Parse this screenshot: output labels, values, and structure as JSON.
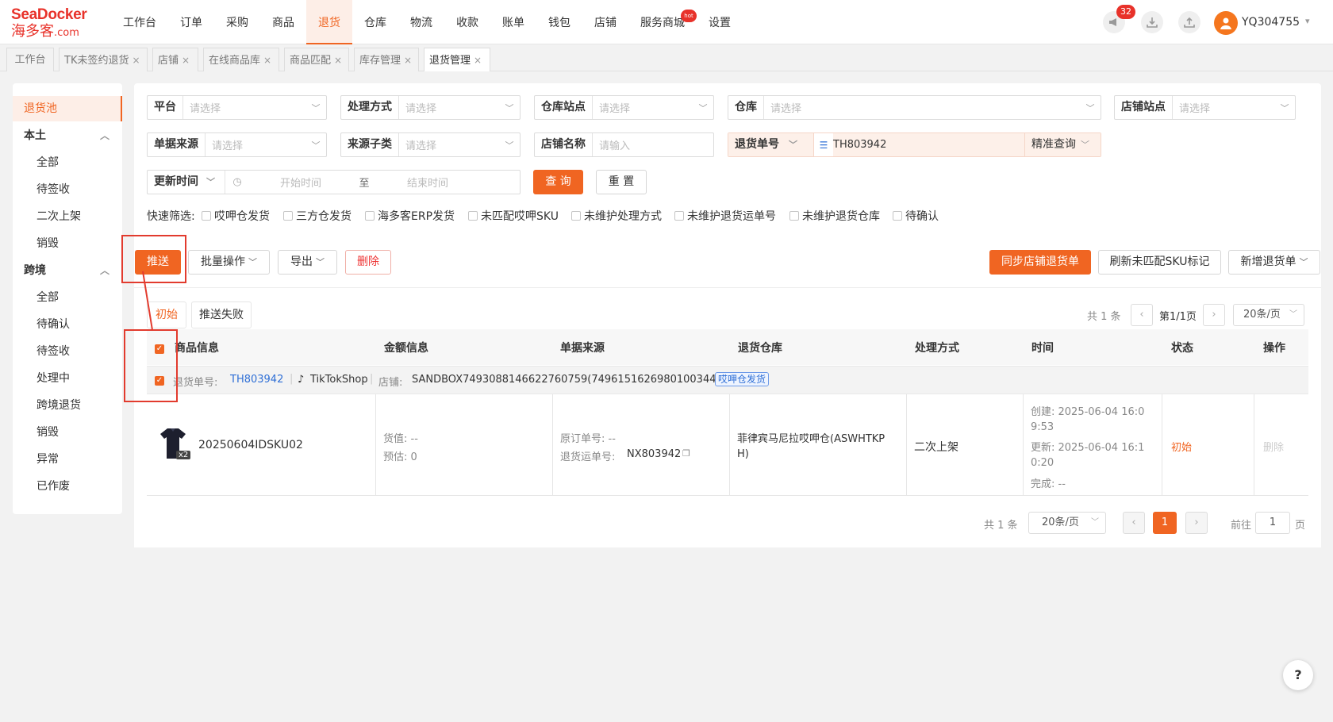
{
  "app": {
    "logo_top": "SeaDocker",
    "logo_bottom": "海多客",
    "logo_suffix": ".com"
  },
  "nav": {
    "items": [
      "工作台",
      "订单",
      "采购",
      "商品",
      "退货",
      "仓库",
      "物流",
      "收款",
      "账单",
      "钱包",
      "店铺",
      "服务商城",
      "设置"
    ],
    "active": "退货",
    "hot_label": "hot"
  },
  "header": {
    "notify_count": "32",
    "username": "YQ304755"
  },
  "tabs": [
    {
      "label": "工作台",
      "closable": false
    },
    {
      "label": "TK未签约退货",
      "closable": true
    },
    {
      "label": "店铺",
      "closable": true
    },
    {
      "label": "在线商品库",
      "closable": true
    },
    {
      "label": "商品匹配",
      "closable": true
    },
    {
      "label": "库存管理",
      "closable": true
    },
    {
      "label": "退货管理",
      "closable": true,
      "active": true
    }
  ],
  "sidebar": {
    "pool": "退货池",
    "local": {
      "title": "本土",
      "items": [
        "全部",
        "待签收",
        "二次上架",
        "销毁"
      ]
    },
    "cross": {
      "title": "跨境",
      "items": [
        "全部",
        "待确认",
        "待签收",
        "处理中",
        "跨境退货",
        "销毁",
        "异常",
        "已作废"
      ]
    }
  },
  "filters": {
    "platform": {
      "label": "平台",
      "placeholder": "请选择"
    },
    "process_method": {
      "label": "处理方式",
      "placeholder": "请选择"
    },
    "wh_site": {
      "label": "仓库站点",
      "placeholder": "请选择"
    },
    "warehouse": {
      "label": "仓库",
      "placeholder": "请选择"
    },
    "shop_site": {
      "label": "店铺站点",
      "placeholder": "请选择"
    },
    "doc_source": {
      "label": "单据来源",
      "placeholder": "请选择"
    },
    "source_sub": {
      "label": "来源子类",
      "placeholder": "请选择"
    },
    "shop_name": {
      "label": "店铺名称",
      "placeholder": "请输入"
    },
    "return_no": {
      "label": "退货单号",
      "value": "TH803942",
      "mode": "精准查询"
    },
    "update_time": {
      "label": "更新时间",
      "start": "开始时间",
      "to": "至",
      "end": "结束时间"
    },
    "query_btn": "查 询",
    "reset_btn": "重 置"
  },
  "quick": {
    "label": "快速筛选:",
    "items": [
      "哎呷仓发货",
      "三方仓发货",
      "海多客ERP发货",
      "未匹配哎呷SKU",
      "未维护处理方式",
      "未维护退货运单号",
      "未维护退货仓库",
      "待确认"
    ]
  },
  "actions": {
    "push": "推送",
    "batch": "批量操作",
    "export": "导出",
    "delete": "删除",
    "sync": "同步店铺退货单",
    "refresh": "刷新未匹配SKU标记",
    "add": "新增退货单"
  },
  "subtabs": {
    "initial": "初始",
    "failed": "推送失败"
  },
  "pager_top": {
    "total": "共 1 条",
    "page": "第1/1页",
    "size": "20条/页"
  },
  "table": {
    "headers": [
      "商品信息",
      "金额信息",
      "单据来源",
      "退货仓库",
      "处理方式",
      "时间",
      "状态",
      "操作"
    ],
    "group": {
      "no_label": "退货单号:",
      "no": "TH803942",
      "platform": "TikTokShop",
      "shop_label": "店铺:",
      "shop": "SANDBOX7493088146622760759(7496151626980100344)",
      "tag": "哎呷仓发货"
    },
    "row": {
      "sku": "20250604IDSKU02",
      "qty": "x2",
      "goods_value": "货值: --",
      "estimate": "预估: 0",
      "orig_no": "原订单号: --",
      "return_waybill_label": "退货运单号:",
      "return_waybill": "NX803942",
      "warehouse_l1": "菲律宾马尼拉哎呷仓(ASWHTKP",
      "warehouse_l2": "H)",
      "method": "二次上架",
      "created_l1": "创建: 2025-06-04 16:0",
      "created_l2": "9:53",
      "updated_l1": "更新: 2025-06-04 16:1",
      "updated_l2": "0:20",
      "finished": "完成: --",
      "status": "初始",
      "op": "删除"
    }
  },
  "pager_bottom": {
    "total": "共 1 条",
    "size": "20条/页",
    "current": "1",
    "goto_label": "前往",
    "goto_value": "1",
    "page_suffix": "页"
  },
  "colors": {
    "accent": "#f06522",
    "red_annotation": "#e23b2e",
    "link": "#2f6fd6"
  }
}
